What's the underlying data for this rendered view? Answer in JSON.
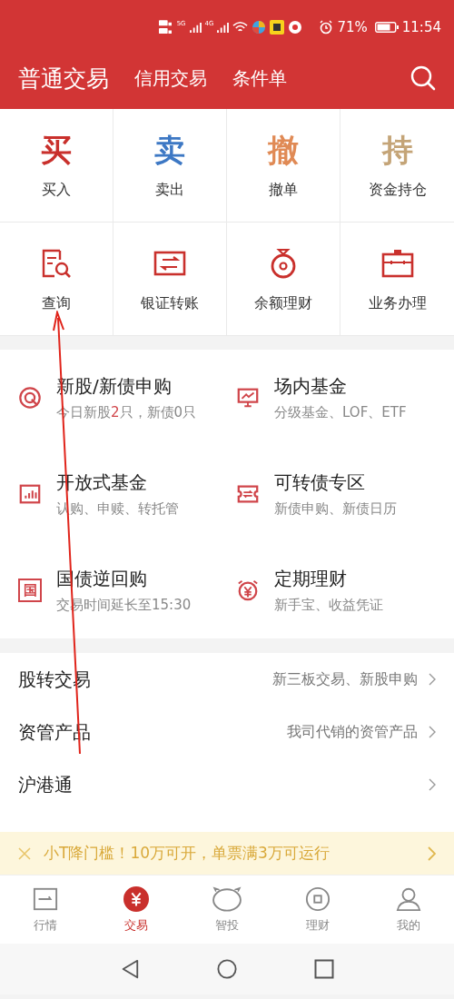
{
  "status_bar": {
    "network_5g": "5G",
    "network_4g": "4G",
    "battery": "71%",
    "time": "11:54"
  },
  "header": {
    "tabs": [
      {
        "label": "普通交易",
        "selected": true
      },
      {
        "label": "信用交易",
        "selected": false
      },
      {
        "label": "条件单",
        "selected": false
      }
    ]
  },
  "quick_actions": [
    {
      "glyph": "买",
      "color": "#c9302c",
      "label": "买入",
      "kind": "glyph"
    },
    {
      "glyph": "卖",
      "color": "#3d78c4",
      "label": "卖出",
      "kind": "glyph"
    },
    {
      "glyph": "撤",
      "color": "#e08a55",
      "label": "撤单",
      "kind": "glyph"
    },
    {
      "glyph": "持",
      "color": "#c4a477",
      "label": "资金持仓",
      "kind": "glyph"
    },
    {
      "label": "查询",
      "kind": "query"
    },
    {
      "label": "银证转账",
      "kind": "transfer"
    },
    {
      "label": "余额理财",
      "kind": "moneybag"
    },
    {
      "label": "业务办理",
      "kind": "briefcase"
    }
  ],
  "features": [
    {
      "title": "新股/新债申购",
      "subtitle": "今日新股**2**只，新债0只",
      "kind": "lottery"
    },
    {
      "title": "场内基金",
      "subtitle": "分级基金、LOF、ETF",
      "kind": "monitor"
    },
    {
      "title": "开放式基金",
      "subtitle": "认购、申赎、转托管",
      "kind": "bars"
    },
    {
      "title": "可转债专区",
      "subtitle": "新债申购、新债日历",
      "kind": "ticket"
    },
    {
      "title": "国债逆回购",
      "subtitle": "交易时间延长至15:30",
      "kind": "national",
      "glyph": "国"
    },
    {
      "title": "定期理财",
      "subtitle": "新手宝、收益凭证",
      "kind": "clock"
    }
  ],
  "menu": [
    {
      "label": "股转交易",
      "detail": "新三板交易、新股申购"
    },
    {
      "label": "资管产品",
      "detail": "我司代销的资管产品"
    },
    {
      "label": "沪港通"
    }
  ],
  "banner": {
    "text": "小T降门槛！10万可开，单票满3万可运行"
  },
  "tab_bar": [
    {
      "label": "行情",
      "kind": "quotes",
      "selected": false
    },
    {
      "label": "交易",
      "kind": "trade",
      "selected": true
    },
    {
      "label": "智投",
      "kind": "robot",
      "selected": false
    },
    {
      "label": "理财",
      "kind": "wealth",
      "selected": false
    },
    {
      "label": "我的",
      "kind": "profile",
      "selected": false
    }
  ]
}
